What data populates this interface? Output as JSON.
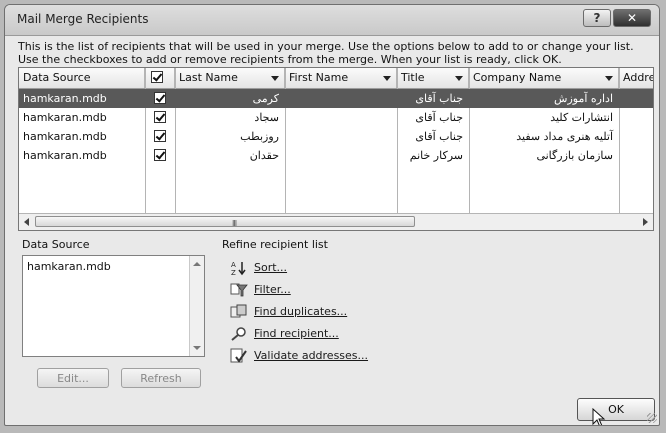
{
  "window": {
    "title": "Mail Merge Recipients",
    "help_label": "?",
    "close_label": "✕"
  },
  "intro_text": "This is the list of recipients that will be used in your merge.  Use the options below to add to or change your list.  Use the checkboxes to add or remove recipients from the merge.  When your list is ready, click OK.",
  "grid": {
    "headers": [
      "Data Source",
      "",
      "Last Name",
      "First Name",
      "Title",
      "Company Name",
      "Addre"
    ],
    "rows": [
      {
        "source": "hamkaran.mdb",
        "last": "کرمی",
        "first": "",
        "title": "جناب آقای",
        "company": "اداره آموزش",
        "selected": true
      },
      {
        "source": "hamkaran.mdb",
        "last": "سجاد",
        "first": "",
        "title": "جناب آقای",
        "company": "انتشارات کلید",
        "selected": false
      },
      {
        "source": "hamkaran.mdb",
        "last": "روزبطب",
        "first": "",
        "title": "جناب آقای",
        "company": "آتلیه هنری مداد سفید",
        "selected": false
      },
      {
        "source": "hamkaran.mdb",
        "last": "حقدان",
        "first": "",
        "title": "سرکار خانم",
        "company": "سازمان بازرگانی",
        "selected": false
      }
    ],
    "scroll_grip": "III"
  },
  "data_source": {
    "label": "Data Source",
    "items": [
      "hamkaran.mdb"
    ],
    "edit_label": "Edit...",
    "refresh_label": "Refresh"
  },
  "refine": {
    "label": "Refine recipient list",
    "items": [
      "Sort...",
      "Filter...",
      "Find duplicates...",
      "Find recipient...",
      "Validate addresses..."
    ]
  },
  "ok_label": "OK"
}
